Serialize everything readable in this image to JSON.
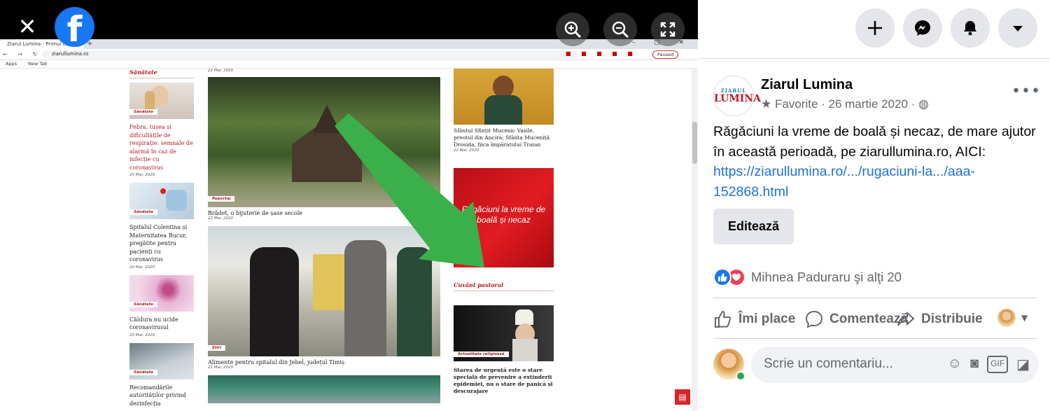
{
  "viewer": {
    "close_symbol": "✕",
    "fb_logo": "f",
    "buttons": [
      "zoom-in-icon",
      "zoom-out-icon",
      "fullscreen-icon"
    ]
  },
  "browser": {
    "tab_title": "Ziarul Lumina - Primul cotidia",
    "url": "ziarullumina.ro",
    "paused_label": "Paused",
    "bookmarks": [
      "Apps",
      "New Tab"
    ]
  },
  "site": {
    "left_header": "Sănătate",
    "left_items": [
      {
        "badge": "Sănătate",
        "title": "Febra, tusea și dificultățile de respirație: semnale de alarmă în caz de infecție cu coronavirus",
        "date": "20 Mar, 2020"
      },
      {
        "badge": "Sănătate",
        "title": "Spitalul Colentina și Maternitatea Bucur, pregătite pentru pacienți cu coronavirus",
        "date": "20 Mar, 2020"
      },
      {
        "badge": "Sănătate",
        "title": "Căldura nu ucide coronavirusul",
        "date": "20 Mar, 2020"
      },
      {
        "badge": "Sănătate",
        "title": "Recomandările autorităților privind dezinfecția",
        "date": ""
      }
    ],
    "mid_items": [
      {
        "badge": "Reportaj",
        "title": "Brădet, o bijuterie de șase secole",
        "date": "22 Mar, 2020"
      },
      {
        "badge": "Știri",
        "title": "Alimente pentru spitalul din Jebel, județul Timiș",
        "date": "21 Mar, 2020"
      }
    ],
    "mid_top_date": "22 Mar, 2020",
    "right_top": {
      "title": "Sfântul Sfințit Mucenic Vasile, preotul din Ancira; Sfânta Muceniță Drosida, fiica împăratului Traian",
      "date": "22 Mar, 2020"
    },
    "red_box": "Rugăciuni la vreme de boală și necaz",
    "pastoral_header": "Cuvânt pastoral",
    "right_bottom": {
      "badge": "Actualitate religioasă",
      "title": "Starea de urgență este o stare specială de prevenire a extinderii epidemiei, nu o stare de panică și descurajare"
    }
  },
  "post": {
    "page_name": "Ziarul Lumina",
    "avatar_small": "ZIARUL",
    "avatar_large": "LUMINA",
    "meta": "Favorite · 26 martie 2020 ·",
    "text": "Rǎgǎciuni la vreme de boalǎ și necaz, de mare ajutor în această perioadǎ, pe ziarullumina.ro, AICI: ",
    "link": "https://ziarullumina.ro/.../rugaciuni-la.../aaa-152868.html",
    "edit_label": "Editează",
    "reactions_text": "Mihnea Paduraru şi alţi 20",
    "actions": {
      "like": "Îmi place",
      "comment": "Comentează",
      "share": "Distribuie"
    },
    "comment_placeholder": "Scrie un comentariu..."
  },
  "colors": {
    "fb_blue": "#1877f2",
    "site_red": "#b01c22",
    "arrow_green": "#3bb04a"
  }
}
